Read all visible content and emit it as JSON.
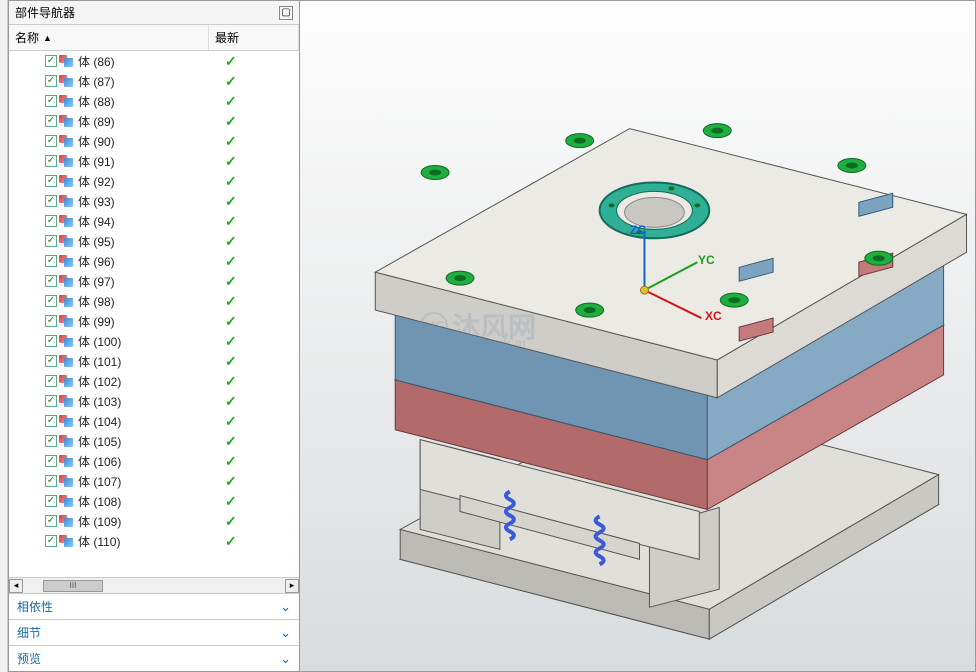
{
  "panel": {
    "title": "部件导航器",
    "columns": {
      "name": "名称",
      "latest": "最新"
    },
    "sections": {
      "dependency": "相依性",
      "detail": "细节",
      "preview": "预览"
    },
    "scrollbar_label": "III"
  },
  "tree": {
    "prefix": "体",
    "items": [
      {
        "id": "86"
      },
      {
        "id": "87"
      },
      {
        "id": "88"
      },
      {
        "id": "89"
      },
      {
        "id": "90"
      },
      {
        "id": "91"
      },
      {
        "id": "92"
      },
      {
        "id": "93"
      },
      {
        "id": "94"
      },
      {
        "id": "95"
      },
      {
        "id": "96"
      },
      {
        "id": "97"
      },
      {
        "id": "98"
      },
      {
        "id": "99"
      },
      {
        "id": "100"
      },
      {
        "id": "101"
      },
      {
        "id": "102"
      },
      {
        "id": "103"
      },
      {
        "id": "104"
      },
      {
        "id": "105"
      },
      {
        "id": "106"
      },
      {
        "id": "107"
      },
      {
        "id": "108"
      },
      {
        "id": "109"
      },
      {
        "id": "110"
      }
    ]
  },
  "viewport": {
    "axes": {
      "x": "XC",
      "y": "YC",
      "z": "ZC"
    },
    "watermark": {
      "main": "沐风网",
      "sub": "www.m  .com"
    }
  },
  "colors": {
    "plate_top": "#e6e4df",
    "plate_blue": "#7ca3c0",
    "plate_red": "#c47a7a",
    "plate_gray": "#b9b7b2",
    "hole_green": "#1fae3f",
    "ring_teal": "#2faf96",
    "spring_blue": "#3b5bd6",
    "axis_z": "#1560d0",
    "axis_y": "#17a017",
    "axis_x": "#d01515"
  }
}
